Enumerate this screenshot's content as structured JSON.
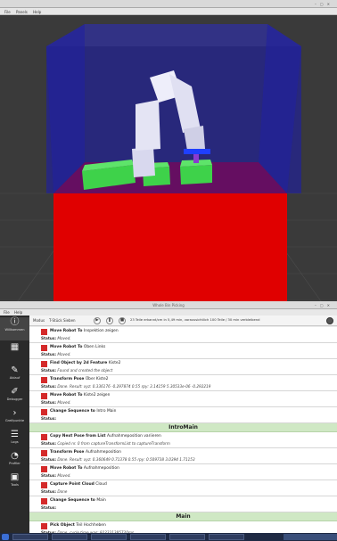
{
  "viewer": {
    "title": "",
    "menu": [
      "File",
      "Panels",
      "Help"
    ]
  },
  "app": {
    "title": "Whole Bin Picking",
    "menu": [
      "File",
      "Help"
    ],
    "sidebar": [
      {
        "icon": "info-icon",
        "glyph": "ⓘ",
        "label": "Willkommen"
      },
      {
        "icon": "grid-icon",
        "glyph": "▦",
        "label": ""
      },
      {
        "icon": "pencil-icon",
        "glyph": "✎",
        "label": "Ablauf"
      },
      {
        "icon": "wrench-icon",
        "glyph": "✐",
        "label": "Debugger"
      },
      {
        "icon": "chevron-icon",
        "glyph": "›",
        "label": "Greifpunkte"
      },
      {
        "icon": "list-icon",
        "glyph": "☰",
        "label": "Logs"
      },
      {
        "icon": "profiler-icon",
        "glyph": "◔",
        "label": "Profiler"
      },
      {
        "icon": "tools-icon",
        "glyph": "▣",
        "label": "Tools"
      }
    ],
    "toolbar": {
      "mode_label": "Modus",
      "mode_value": "T-Stück Sieben",
      "status": "23 Teile erkannt/cm in 5,49 min, voraussichtlich 100 Teile / 30 min verbleibend"
    },
    "status_label": "Status:",
    "log": [
      {
        "type": "entry",
        "action": "Move Robot To",
        "arg": "Inspektion zeigen",
        "status": "Moved."
      },
      {
        "type": "entry",
        "action": "Move Robot To",
        "arg": "Oben Links",
        "status": "Moved."
      },
      {
        "type": "entry",
        "action": "Find Object by 2d Feature",
        "arg": "Kiste2",
        "status": "Found and created the object"
      },
      {
        "type": "entry",
        "action": "Transform Pose",
        "arg": "Über Kiste2",
        "status": "Done. Result: xyz: 0.336176 -0.297874 0.55 rpy: 3.14159 5.30533e-06 -0.292219"
      },
      {
        "type": "entry",
        "action": "Move Robot To",
        "arg": "Kiste2 zeigen",
        "status": "Moved."
      },
      {
        "type": "entry",
        "action": "Change Sequence to",
        "arg": "Intro Main",
        "status": ""
      },
      {
        "type": "section",
        "title": "IntroMain"
      },
      {
        "type": "entry",
        "action": "Copy Next Pose from List",
        "arg": "Aufnahmeposition variieren",
        "status": "Copied nr. 0 from captureTransformList to captureTransform"
      },
      {
        "type": "entry",
        "action": "Transform Pose",
        "arg": "Aufnahmeposition",
        "status": "Done. Result: xyz: 0.360649 0.71378 0.55 rpy: 0.509738 3.0394 1.71153"
      },
      {
        "type": "entry",
        "action": "Move Robot To",
        "arg": "Aufnahmeposition",
        "status": "Moved."
      },
      {
        "type": "entry",
        "action": "Capture Point Cloud",
        "arg": "Cloud",
        "status": "Done"
      },
      {
        "type": "entry",
        "action": "Change Sequence to",
        "arg": "Main",
        "status": ""
      },
      {
        "type": "section",
        "title": "Main"
      },
      {
        "type": "entry",
        "action": "Pick Object",
        "arg": "Teil Hochheben",
        "status": "Done, cycle time was: 922331385720ms"
      }
    ]
  },
  "colors": {
    "status_red": "#d42a2a",
    "section_green": "#cfe8c4",
    "box_green": "#3ed24a",
    "table_red": "#e00000",
    "enclosure_blue": "#1a1ab0"
  }
}
